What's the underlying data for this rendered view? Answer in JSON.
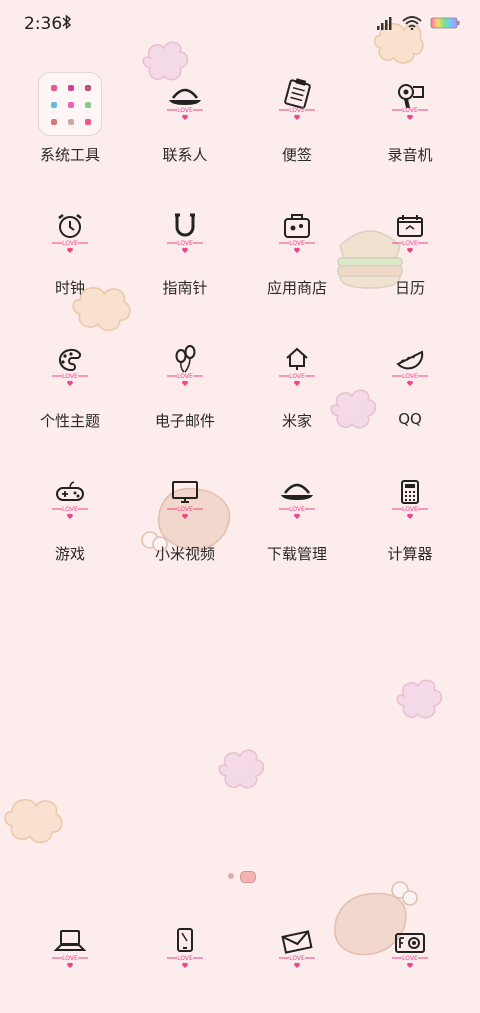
{
  "status_bar": {
    "time": "2:36"
  },
  "apps": [
    {
      "label": "系统工具",
      "icon": "folder-icon"
    },
    {
      "label": "联系人",
      "icon": "hat-icon"
    },
    {
      "label": "便签",
      "icon": "notepad-icon"
    },
    {
      "label": "录音机",
      "icon": "hairdryer-icon"
    },
    {
      "label": "时钟",
      "icon": "alarm-clock-icon"
    },
    {
      "label": "指南针",
      "icon": "magnet-icon"
    },
    {
      "label": "应用商店",
      "icon": "suitcase-icon"
    },
    {
      "label": "日历",
      "icon": "calendar-icon"
    },
    {
      "label": "个性主题",
      "icon": "palette-icon"
    },
    {
      "label": "电子邮件",
      "icon": "balloons-icon"
    },
    {
      "label": "米家",
      "icon": "house-icon"
    },
    {
      "label": "QQ",
      "icon": "watermelon-icon"
    },
    {
      "label": "游戏",
      "icon": "gamepad-icon"
    },
    {
      "label": "小米视频",
      "icon": "monitor-icon"
    },
    {
      "label": "下载管理",
      "icon": "hat-icon"
    },
    {
      "label": "计算器",
      "icon": "calculator-icon"
    }
  ],
  "icon_badge_text": "LOVE",
  "dock": [
    {
      "icon": "laptop-icon"
    },
    {
      "icon": "phone-icon"
    },
    {
      "icon": "envelope-icon"
    },
    {
      "icon": "camera-icon"
    }
  ],
  "page_indicator": {
    "pages": 2,
    "current": 2
  },
  "colors": {
    "background": "#fcecec",
    "love": "#f1428c"
  }
}
